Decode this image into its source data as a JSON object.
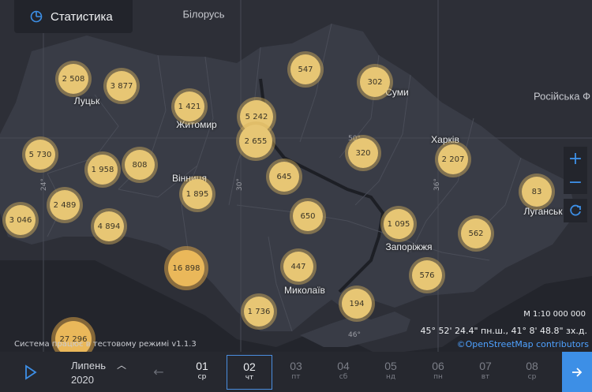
{
  "header": {
    "stats_label": "Статистика"
  },
  "countries": {
    "belarus": "Білорусь",
    "russia": "Російська Ф"
  },
  "cities": {
    "lutsk": "Луцьк",
    "zhytomyr": "Житомир",
    "vinnytsia": "Вінниця",
    "sumy": "Суми",
    "kharkiv": "Харків",
    "luhansk": "Луганськ",
    "zaporizhzhia": "Запоріжжя",
    "mykolaiv": "Миколаїв"
  },
  "graticule": {
    "lat50": "50°",
    "lon24": "24°",
    "lon30": "30°",
    "lon36": "36°",
    "lon46": "46°"
  },
  "clusters": {
    "lutsk_w": "2 508",
    "lutsk_e": "3 877",
    "zhytomyr": "1 421",
    "kyiv_n": "5 242",
    "kyiv_s": "2 655",
    "chernihiv": "547",
    "sumy": "302",
    "lviv": "5 730",
    "ternopil": "1 958",
    "khmelnytskyi": "808",
    "vinnytsia": "1 895",
    "cherkasy": "645",
    "poltava": "320",
    "kharkiv": "2 207",
    "luhansk": "83",
    "zakarpattia": "3 046",
    "ivano_frankivsk": "2 489",
    "chernivtsi": "4 894",
    "kirovohrad": "650",
    "zaporizhzhia": "1 095",
    "donetsk": "562",
    "odesa_n": "16 898",
    "mykolaiv": "447",
    "melitopol": "576",
    "kherson": "194",
    "odesa": "1 736",
    "crimea": "27 296"
  },
  "footer": {
    "version": "Система працює в тестовому режимі v1.1.3",
    "scale": "М 1:10 000 000",
    "coords": "45° 52' 24.4\" пн.ш., 41° 8' 48.8\" зх.д.",
    "osm": "©OpenStreetMap contributors"
  },
  "timeline": {
    "month": "Липень",
    "year": "2020",
    "days": [
      {
        "d": "01",
        "w": "ср"
      },
      {
        "d": "02",
        "w": "чт"
      },
      {
        "d": "03",
        "w": "пт"
      },
      {
        "d": "04",
        "w": "сб"
      },
      {
        "d": "05",
        "w": "нд"
      },
      {
        "d": "06",
        "w": "пн"
      },
      {
        "d": "07",
        "w": "вт"
      },
      {
        "d": "08",
        "w": "ср"
      }
    ]
  },
  "colors": {
    "accent": "#3d8fe6",
    "cluster": "#e7c674",
    "background": "#2c2e36"
  }
}
